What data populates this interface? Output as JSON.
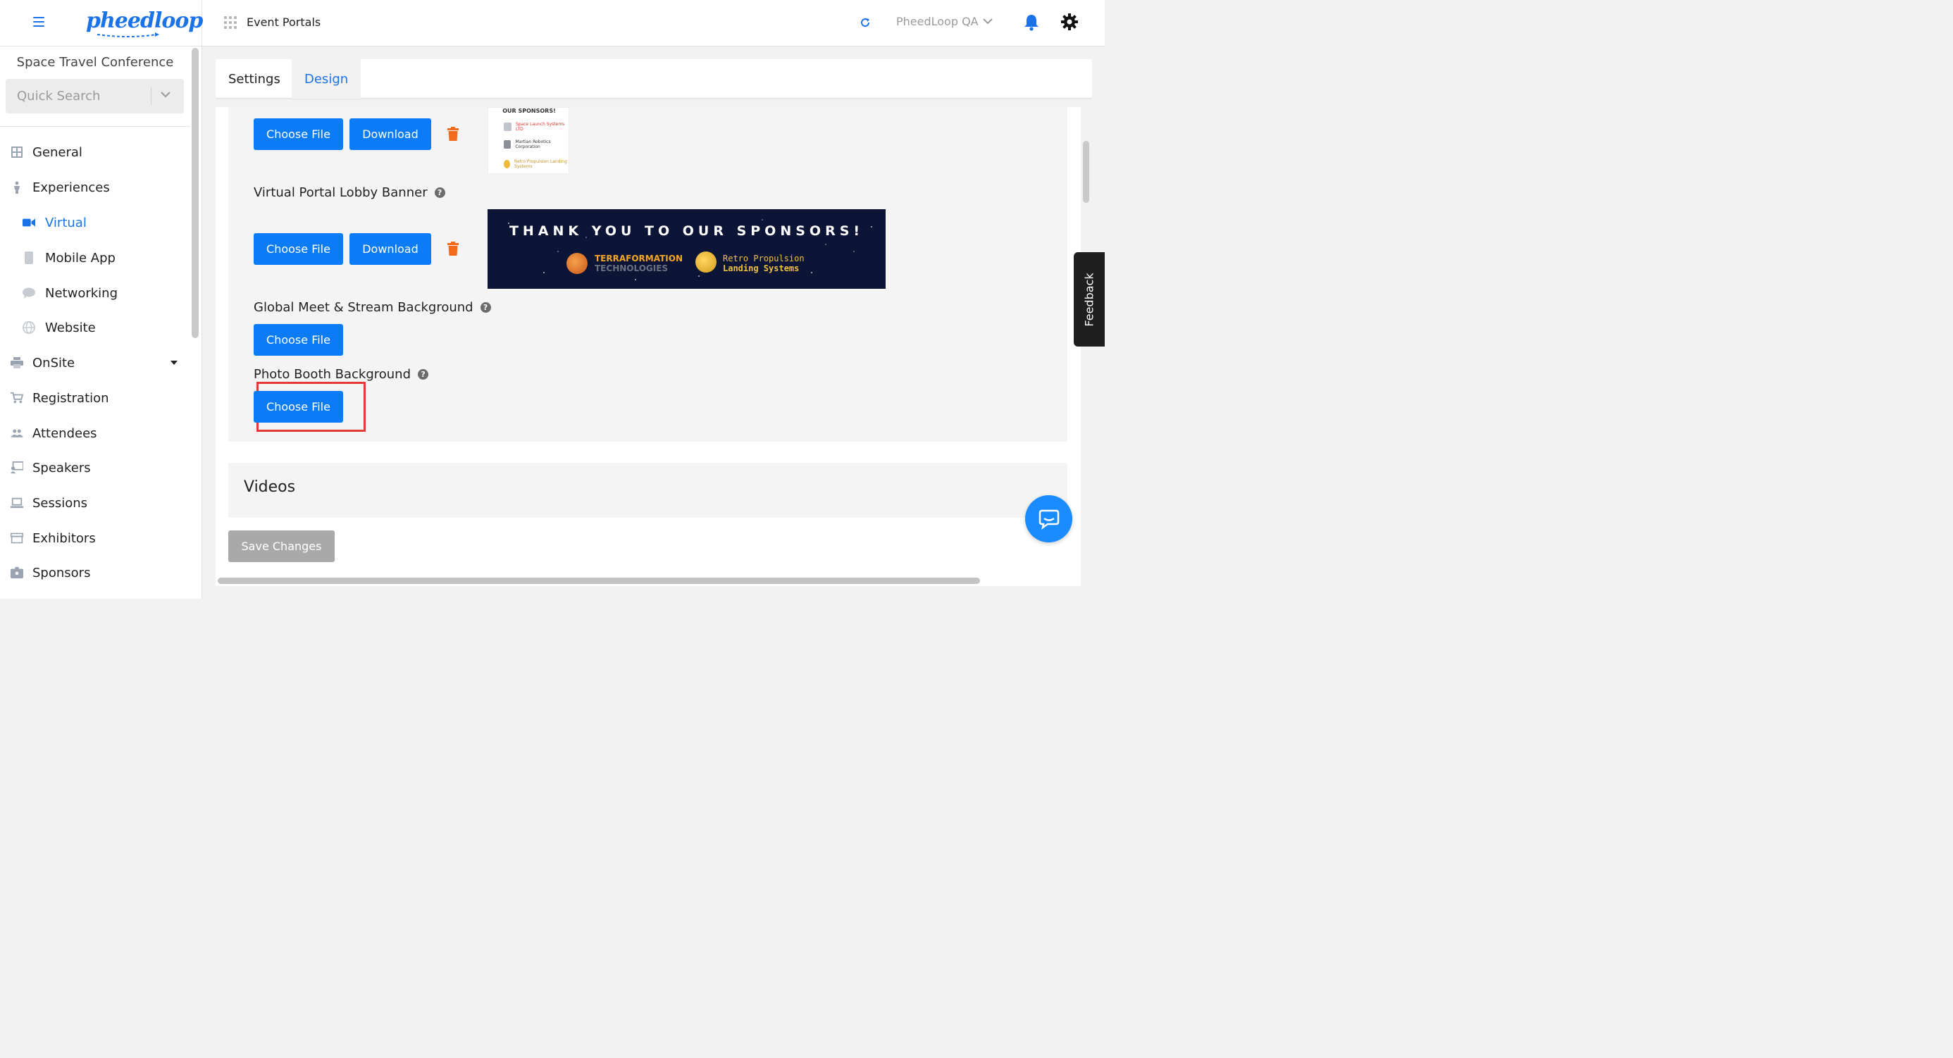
{
  "header": {
    "logo_text": "pheedloop",
    "portals_label": "Event Portals",
    "org_name": "PheedLoop QA"
  },
  "sidebar": {
    "event_name": "Space Travel Conference",
    "search_placeholder": "Quick Search",
    "items": [
      {
        "label": "General",
        "icon": "grid-icon"
      },
      {
        "label": "Experiences",
        "icon": "person-icon"
      },
      {
        "label": "Virtual",
        "icon": "video-camera-icon",
        "active": true
      },
      {
        "label": "Mobile App",
        "icon": "mobile-icon"
      },
      {
        "label": "Networking",
        "icon": "chat-bubble-icon"
      },
      {
        "label": "Website",
        "icon": "globe-icon"
      },
      {
        "label": "OnSite",
        "icon": "printer-icon"
      },
      {
        "label": "Registration",
        "icon": "cart-icon"
      },
      {
        "label": "Attendees",
        "icon": "people-icon"
      },
      {
        "label": "Speakers",
        "icon": "presenter-icon"
      },
      {
        "label": "Sessions",
        "icon": "laptop-icon"
      },
      {
        "label": "Exhibitors",
        "icon": "storefront-icon"
      },
      {
        "label": "Sponsors",
        "icon": "badge-icon"
      }
    ]
  },
  "tabs": {
    "settings": "Settings",
    "design": "Design",
    "active": "Design"
  },
  "design": {
    "choose_file": "Choose File",
    "download": "Download",
    "sponsor_image": {
      "title": "OUR SPONSORS!",
      "rows": [
        "Space Launch Systems LTD",
        "Martian Robotics Corporation",
        "Retro Propulsion Landing Systems"
      ]
    },
    "lobby_banner": {
      "label": "Virtual Portal Lobby Banner",
      "headline": "THANK YOU TO OUR SPONSORS!",
      "sponsor1_line1": "TERRAFORMATION",
      "sponsor1_line2": "TECHNOLOGIES",
      "sponsor2_line1": "Retro Propulsion",
      "sponsor2_line2": "Landing Systems"
    },
    "meet_stream_label": "Global Meet & Stream Background",
    "photo_booth_label": "Photo Booth Background",
    "videos_heading": "Videos",
    "save_changes": "Save Changes"
  },
  "feedback_label": "Feedback",
  "colors": {
    "primary": "#0b7cf6",
    "brand": "#1a73e8",
    "trash": "#f26b1d",
    "highlight": "#e53935",
    "disabled": "#a9a9a9"
  }
}
